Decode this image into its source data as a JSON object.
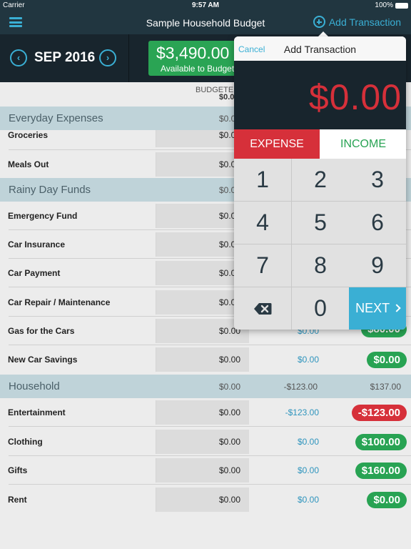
{
  "status_bar": {
    "carrier": "Carrier",
    "time": "9:57 AM",
    "battery": "100%"
  },
  "nav": {
    "title": "Sample Household Budget",
    "add_transaction": "Add Transaction"
  },
  "month": {
    "label": "SEP 2016",
    "prev": "‹",
    "next": "›"
  },
  "available": {
    "amount": "$3,490.00",
    "label": "Available to Budget"
  },
  "columns": {
    "budgeted": "BUDGETED",
    "budgeted_total": "$0.00"
  },
  "categories": [
    {
      "name": "Everyday Expenses",
      "budgeted": "$0.00",
      "activity": "",
      "available": ""
    },
    {
      "name": "Rainy Day Funds",
      "budgeted": "$0.00",
      "activity": "",
      "available": ""
    },
    {
      "name": "Household",
      "budgeted": "$0.00",
      "activity": "-$123.00",
      "available": "$137.00"
    }
  ],
  "items": [
    {
      "name": "Groceries",
      "budgeted": "$0.00",
      "activity": "",
      "available": ""
    },
    {
      "name": "Meals Out",
      "budgeted": "$0.00",
      "activity": "",
      "available": ""
    },
    {
      "name": "Emergency Fund",
      "budgeted": "$0.00",
      "activity": "",
      "available": ""
    },
    {
      "name": "Car Insurance",
      "budgeted": "$0.00",
      "activity": "",
      "available": ""
    },
    {
      "name": "Car Payment",
      "budgeted": "$0.00",
      "activity": "",
      "available": ""
    },
    {
      "name": "Car Repair / Maintenance",
      "budgeted": "$0.00",
      "activity": "",
      "available": ""
    },
    {
      "name": "Gas for the Cars",
      "budgeted": "$0.00",
      "activity": "$0.00",
      "available": "$80.00"
    },
    {
      "name": "New Car Savings",
      "budgeted": "$0.00",
      "activity": "$0.00",
      "available": "$0.00"
    },
    {
      "name": "Entertainment",
      "budgeted": "$0.00",
      "activity": "-$123.00",
      "available": "-$123.00"
    },
    {
      "name": "Clothing",
      "budgeted": "$0.00",
      "activity": "$0.00",
      "available": "$100.00"
    },
    {
      "name": "Gifts",
      "budgeted": "$0.00",
      "activity": "$0.00",
      "available": "$160.00"
    },
    {
      "name": "Rent",
      "budgeted": "$0.00",
      "activity": "$0.00",
      "available": "$0.00"
    }
  ],
  "popover": {
    "cancel": "Cancel",
    "title": "Add Transaction",
    "amount": "$0.00",
    "expense": "EXPENSE",
    "income": "INCOME",
    "keys": [
      "1",
      "2",
      "3",
      "4",
      "5",
      "6",
      "7",
      "8",
      "9",
      "0"
    ],
    "next": "NEXT"
  },
  "colors": {
    "accent": "#3aafd4",
    "positive": "#28a353",
    "negative": "#d6303a",
    "header": "#213640"
  }
}
